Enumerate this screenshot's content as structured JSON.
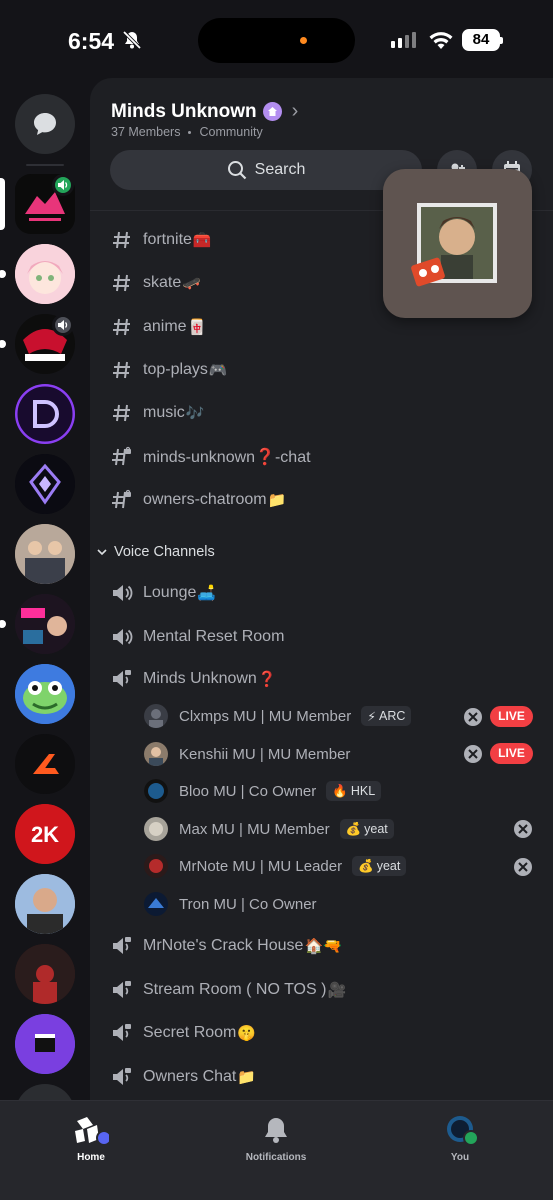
{
  "status_bar": {
    "time": "6:54",
    "battery": "84"
  },
  "server": {
    "name": "Minds Unknown",
    "members": "37 Members",
    "type": "Community"
  },
  "search": {
    "label": "Search"
  },
  "text_channels": [
    {
      "name": "fortnite",
      "emoji": "🧰"
    },
    {
      "name": "skate",
      "emoji": "🛹"
    },
    {
      "name": "anime",
      "emoji": "🀄"
    },
    {
      "name": "top-plays",
      "emoji": "🎮"
    },
    {
      "name": "music",
      "emoji": "🎶"
    },
    {
      "name": "minds-unknown❓-chat",
      "emoji": ""
    },
    {
      "name": "owners-chatroom",
      "emoji": "📁"
    }
  ],
  "voice_category": {
    "label": "Voice Channels"
  },
  "voice_channels_top": [
    {
      "name": "Lounge",
      "emoji": "🛋️"
    },
    {
      "name": "Mental Reset Room",
      "emoji": ""
    },
    {
      "name": "Minds Unknown",
      "emoji": "❓"
    }
  ],
  "voice_members": [
    {
      "name": "Clxmps MU | MU Member",
      "tag_emoji": "⚡",
      "tag": "ARC",
      "live": true
    },
    {
      "name": "Kenshii MU | MU Member",
      "tag_emoji": "",
      "tag": "",
      "live": true
    },
    {
      "name": "Bloo MU | Co Owner",
      "tag_emoji": "🔥",
      "tag": "HKL",
      "live": false
    },
    {
      "name": "Max MU | MU Member",
      "tag_emoji": "💰",
      "tag": "yeat",
      "live": false
    },
    {
      "name": "MrNote MU | MU Leader",
      "tag_emoji": "💰",
      "tag": "yeat",
      "live": false
    },
    {
      "name": "Tron MU | Co Owner",
      "tag_emoji": "",
      "tag": "",
      "live": false
    }
  ],
  "live_label": "LIVE",
  "voice_channels_bottom": [
    {
      "name": "MrNote's Crack House",
      "emoji": "🏠🔫"
    },
    {
      "name": "Stream Room ( NO TOS )",
      "emoji": "🎥"
    },
    {
      "name": "Secret Room",
      "emoji": "🤫"
    },
    {
      "name": "Owners Chat",
      "emoji": "📁"
    }
  ],
  "bottom_nav": {
    "home": "Home",
    "notifications": "Notifications",
    "you": "You"
  },
  "colors": {
    "accent": "#5865f2",
    "live": "#f23f43",
    "online": "#23a55a",
    "background": "#1e1f23"
  },
  "icons": [
    "messages-icon",
    "search-icon",
    "add-members-icon",
    "calendar-icon",
    "hashtag-icon",
    "speaker-icon",
    "xbox-icon",
    "home-icon",
    "bell-icon"
  ]
}
